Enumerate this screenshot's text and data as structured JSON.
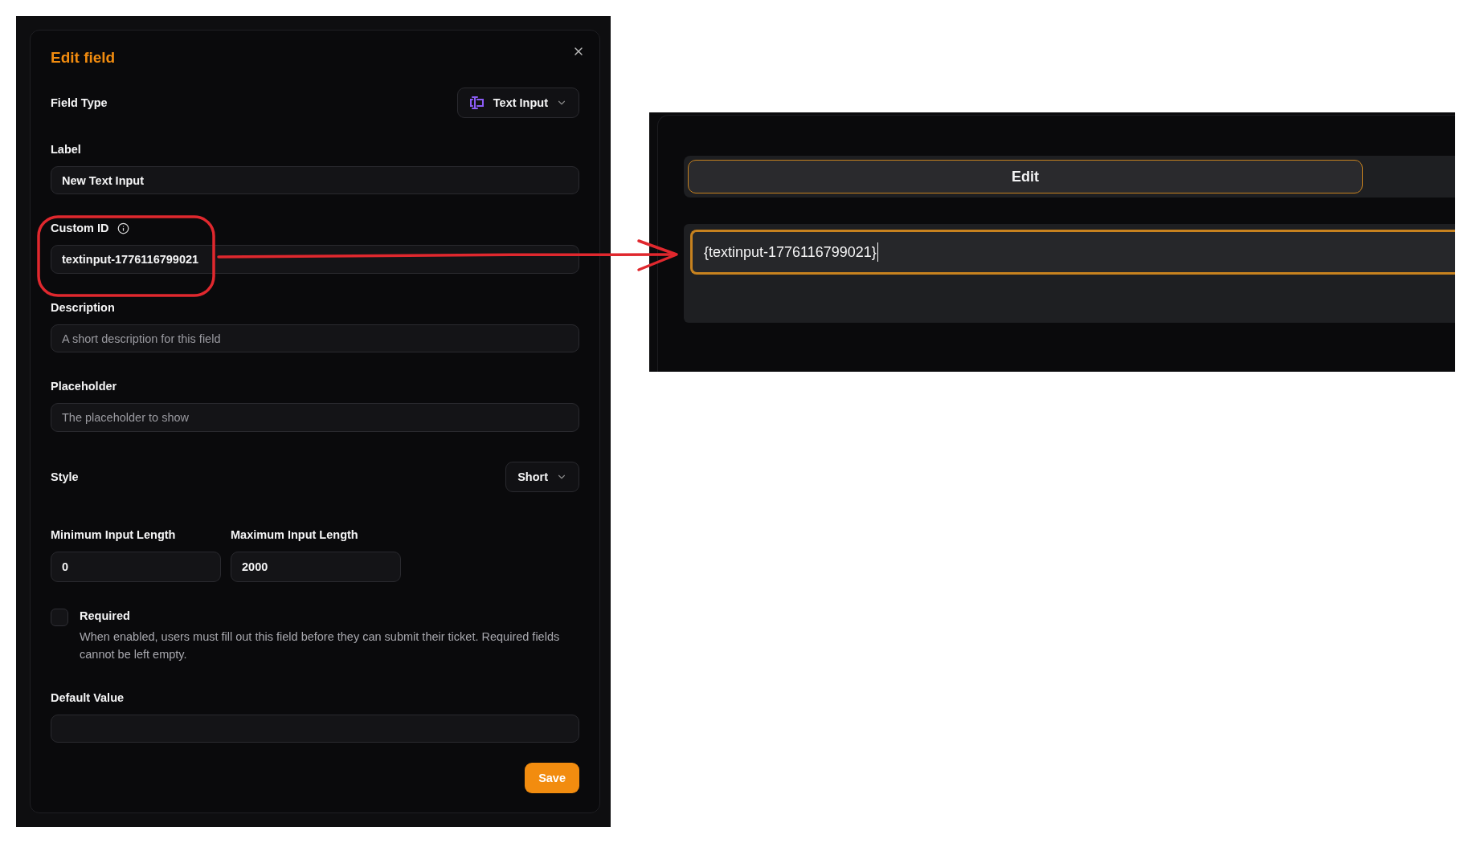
{
  "edit_field_dialog": {
    "title": "Edit field",
    "field_type": {
      "label": "Field Type",
      "value": "Text Input"
    },
    "label": {
      "label": "Label",
      "value": "New Text Input"
    },
    "custom_id": {
      "label": "Custom ID",
      "value": "textinput-1776116799021"
    },
    "description": {
      "label": "Description",
      "placeholder": "A short description for this field"
    },
    "placeholder": {
      "label": "Placeholder",
      "placeholder": "The placeholder to show"
    },
    "style": {
      "label": "Style",
      "value": "Short"
    },
    "min_length": {
      "label": "Minimum Input Length",
      "value": "0"
    },
    "max_length": {
      "label": "Maximum Input Length",
      "value": "2000"
    },
    "required": {
      "label": "Required",
      "checked": false,
      "help": "When enabled, users must fill out this field before they can submit their ticket. Required fields cannot be left empty."
    },
    "default_value": {
      "label": "Default Value"
    },
    "save_button": "Save"
  },
  "preview": {
    "edit_button": "Edit",
    "input": {
      "value": "{textinput-1776116799021}",
      "focused": true
    }
  }
}
